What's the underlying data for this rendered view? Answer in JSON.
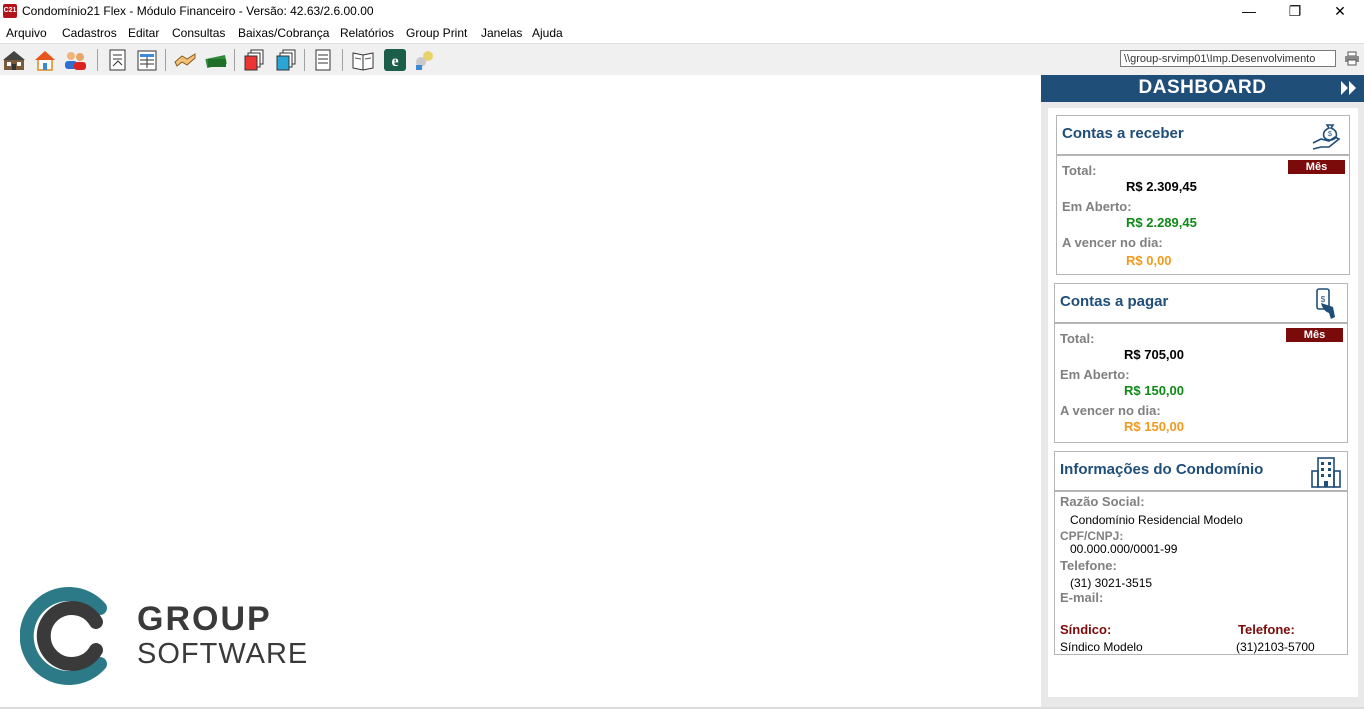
{
  "window": {
    "title": "Condomínio21 Flex - Módulo Financeiro - Versão: 42.63/2.6.00.00",
    "app_icon": "C21",
    "controls": {
      "minimize": "—",
      "maximize": "❐",
      "close": "✕"
    }
  },
  "menu": [
    "Arquivo",
    "Cadastros",
    "Editar",
    "Consultas",
    "Baixas/Cobrança",
    "Relatórios",
    "Group Print",
    "Janelas",
    "Ajuda"
  ],
  "toolbar": {
    "printer_path": "\\\\group-srvimp01\\Imp.Desenvolvimento",
    "icons": [
      "condominios-icon",
      "unidades-icon",
      "pessoas-icon",
      "lancamento-icon",
      "planilha-icon",
      "acordo-icon",
      "pagamento-icon",
      "copias-icon",
      "documentos-icon",
      "relatorio-icon",
      "manual-icon",
      "e-icon",
      "usuarios-icon",
      "printer-icon"
    ]
  },
  "logo": {
    "line1": "GROUP",
    "line2": "SOFTWARE"
  },
  "dashboard": {
    "title": "DASHBOARD",
    "contas_receber": {
      "title": "Contas a receber",
      "badge": "Mês",
      "total_label": "Total:",
      "total_value": "R$ 2.309,45",
      "aberto_label": "Em Aberto:",
      "aberto_value": "R$ 2.289,45",
      "vencer_label": "A vencer no dia:",
      "vencer_value": "R$ 0,00"
    },
    "contas_pagar": {
      "title": "Contas a pagar",
      "badge": "Mês",
      "total_label": "Total:",
      "total_value": "R$ 705,00",
      "aberto_label": "Em Aberto:",
      "aberto_value": "R$ 150,00",
      "vencer_label": "A vencer no dia:",
      "vencer_value": "R$ 150,00"
    },
    "info": {
      "title": "Informações do Condomínio",
      "razao_label": "Razão Social:",
      "razao_value": "Condomínio Residencial Modelo",
      "cnpj_label": "CPF/CNPJ:",
      "cnpj_value": "00.000.000/0001-99",
      "telefone_label": "Telefone:",
      "telefone_value": "(31) 3021-3515",
      "email_label": "E-mail:",
      "sindico_label": "Síndico:",
      "sindico_value": "Síndico Modelo",
      "sindico_tel_label": "Telefone:",
      "sindico_tel_value": "(31)2103-5700"
    }
  },
  "colors": {
    "accent": "#1f4e79",
    "badge": "#7b0a0a",
    "green": "#0e8a16",
    "orange": "#f39a1d"
  }
}
